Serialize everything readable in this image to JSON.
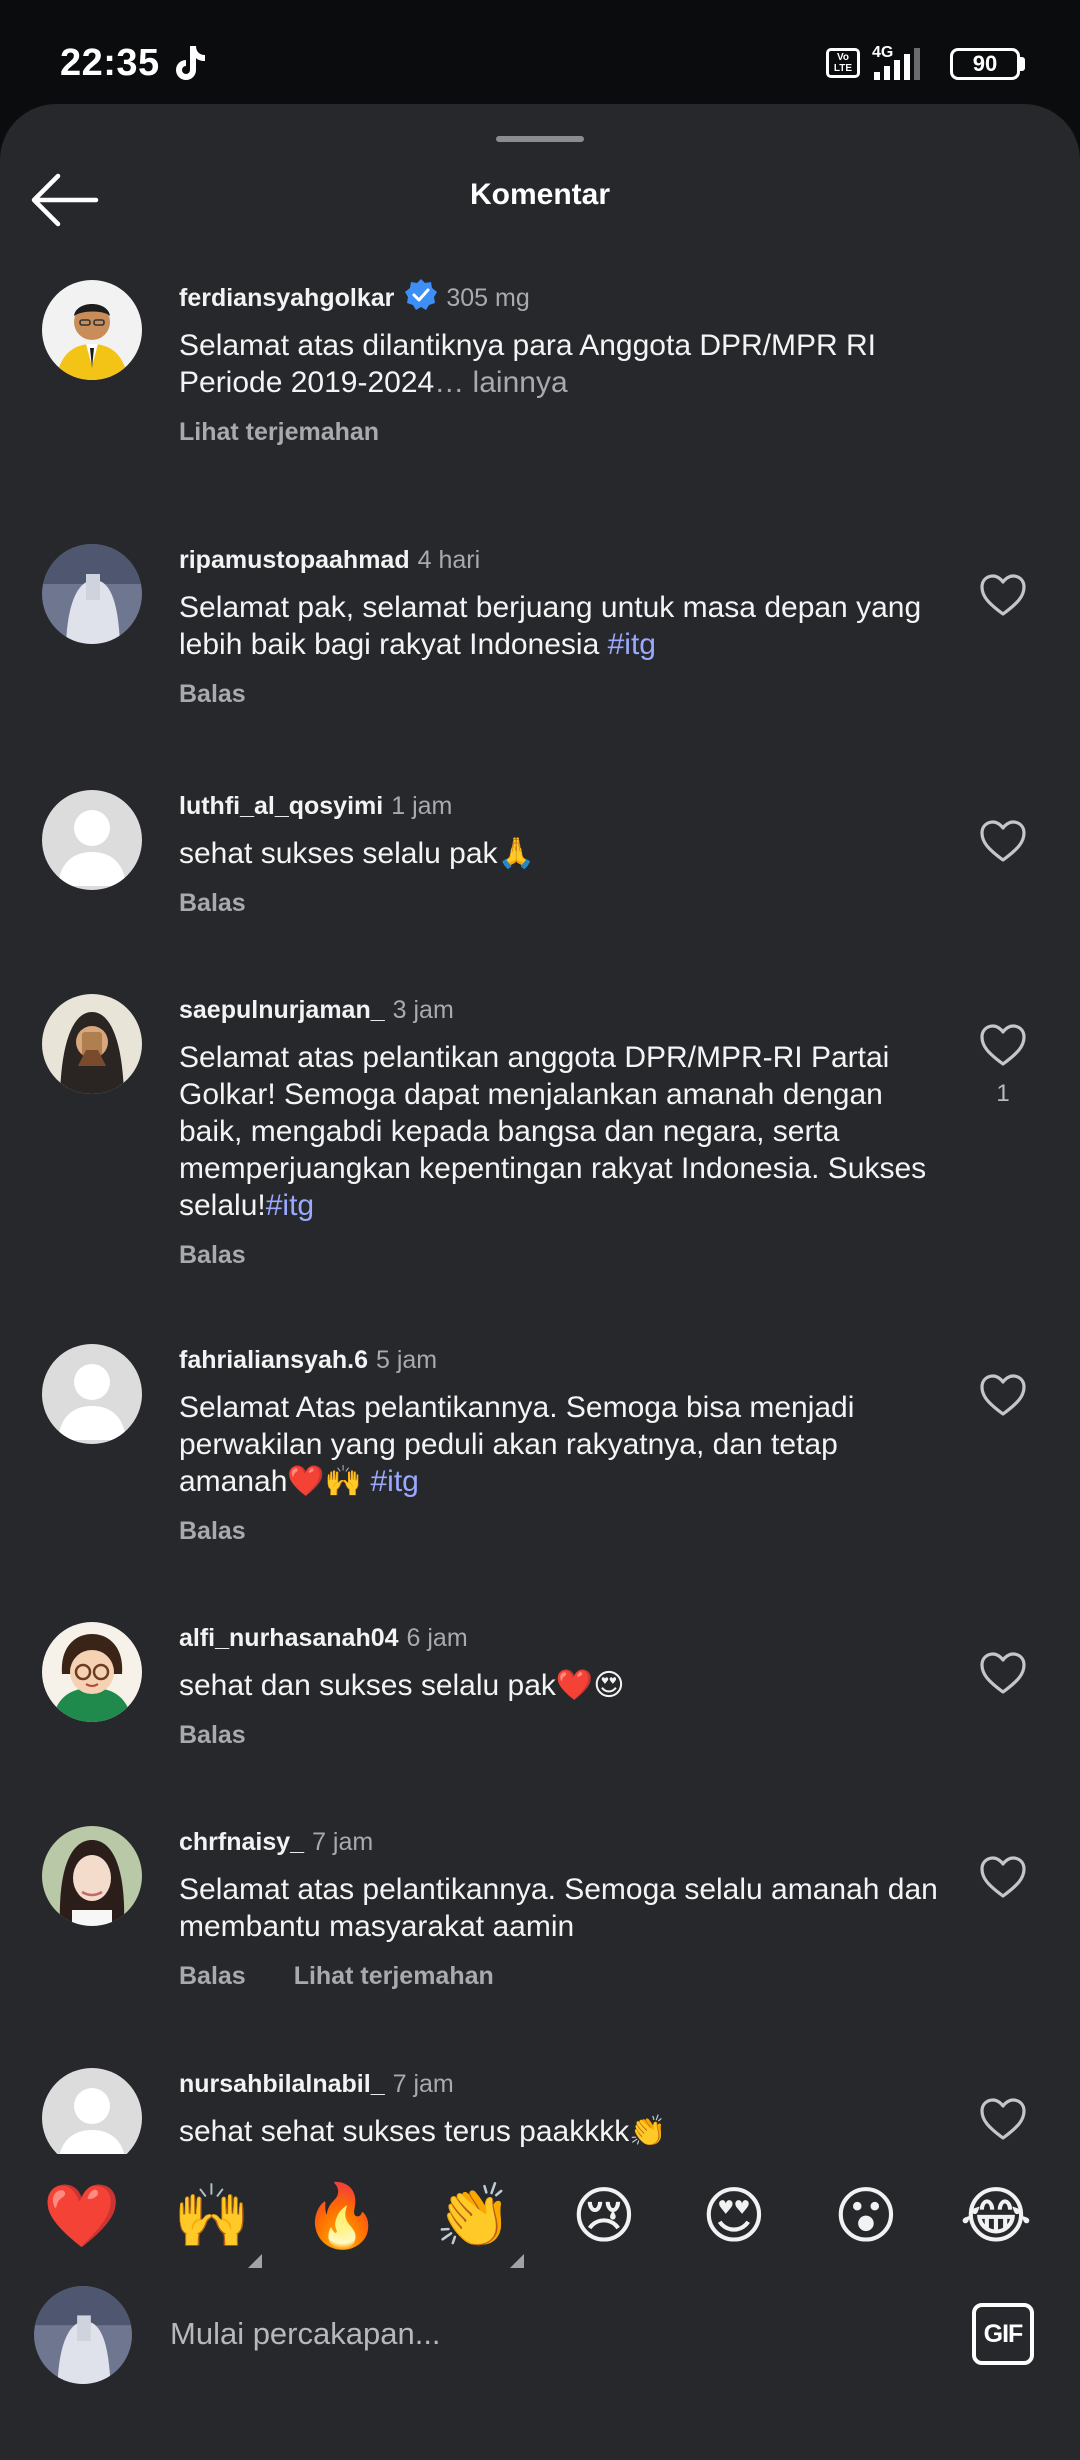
{
  "status_bar": {
    "time": "22:35",
    "lte_label": "Vo LTE",
    "network": "4G",
    "battery": "90"
  },
  "header": {
    "title": "Komentar"
  },
  "comments": [
    {
      "username": "ferdiansyahgolkar",
      "verified": true,
      "time": "305 mg",
      "text": "Selamat atas dilantiknya para Anggota DPR/MPR RI Periode 2019-2024",
      "more": "… lainnya",
      "actions": [
        "Lihat terjemahan"
      ]
    },
    {
      "username": "ripamustopaahmad",
      "time": "4 hari",
      "text": "Selamat pak, selamat berjuang untuk masa depan yang lebih baik bagi rakyat Indonesia ",
      "hashtag": "#itg",
      "actions": [
        "Balas"
      ]
    },
    {
      "username": "luthfi_al_qosyimi",
      "time": "1 jam",
      "text": "sehat sukses selalu pak🙏",
      "actions": [
        "Balas"
      ]
    },
    {
      "username": "saepulnurjaman_",
      "time": "3 jam",
      "text": "Selamat atas pelantikan anggota DPR/MPR-RI Partai Golkar! Semoga dapat menjalankan amanah dengan baik, mengabdi kepada bangsa dan negara, serta memperjuangkan kepentingan rakyat Indonesia. Sukses selalu!",
      "hashtag": "#itg",
      "actions": [
        "Balas"
      ],
      "likes": "1"
    },
    {
      "username": "fahrialiansyah.6",
      "time": "5 jam",
      "text": "Selamat Atas pelantikannya. Semoga bisa menjadi perwakilan yang peduli akan rakyatnya, dan tetap amanah❤️🙌 ",
      "hashtag": "#itg",
      "actions": [
        "Balas"
      ]
    },
    {
      "username": "alfi_nurhasanah04",
      "time": "6 jam",
      "text": "sehat dan sukses selalu pak❤️😍",
      "actions": [
        "Balas"
      ]
    },
    {
      "username": "chrfnaisy_",
      "time": "7 jam",
      "text": "Selamat atas pelantikannya. Semoga selalu amanah dan membantu masyarakat aamin",
      "actions": [
        "Balas",
        "Lihat terjemahan"
      ]
    },
    {
      "username": "nursahbilalnabil_",
      "time": "7 jam",
      "text": "sehat sehat sukses terus paakkkk👏",
      "actions": []
    }
  ],
  "reactions": [
    {
      "emoji": "❤️",
      "icon": "red-heart-icon",
      "has_more": false
    },
    {
      "emoji": "🙌",
      "icon": "raising-hands-icon",
      "has_more": true
    },
    {
      "emoji": "🔥",
      "icon": "fire-icon",
      "has_more": false
    },
    {
      "emoji": "👏",
      "icon": "clapping-hands-icon",
      "has_more": true
    },
    {
      "emoji": "😢",
      "icon": "crying-face-icon",
      "has_more": false
    },
    {
      "emoji": "😍",
      "icon": "heart-eyes-icon",
      "has_more": false
    },
    {
      "emoji": "😮",
      "icon": "surprised-face-icon",
      "has_more": false
    },
    {
      "emoji": "😂",
      "icon": "tears-of-joy-icon",
      "has_more": false
    }
  ],
  "composer": {
    "placeholder": "Mulai percakapan...",
    "gif_label": "GIF"
  },
  "colors": {
    "sheet_bg": "#26282c",
    "page_bg": "#0b0c0e",
    "secondary_text": "#a8aaae",
    "hashtag": "#9aa8ff",
    "verified": "#3d8ff5"
  }
}
